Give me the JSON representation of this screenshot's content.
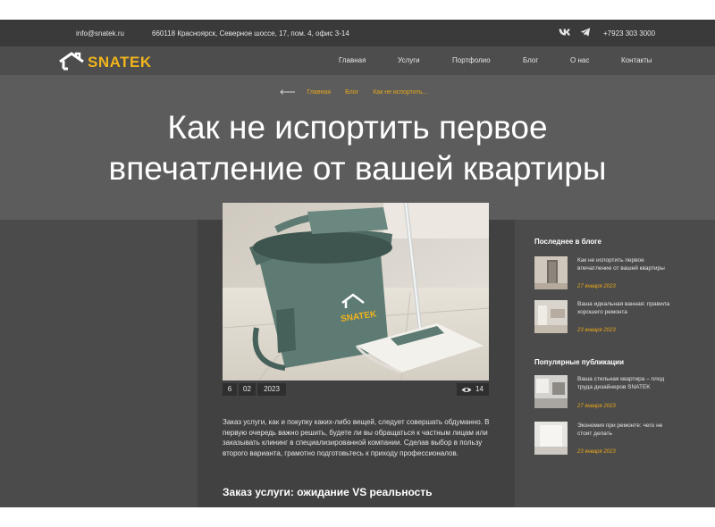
{
  "topbar": {
    "email": "info@snatek.ru",
    "address": "660118 Красноярск, Северное шоссе, 17, пом. 4, офис 3-14",
    "phone": "+7923 303 3000",
    "icons": [
      "vk-icon",
      "telegram-icon"
    ]
  },
  "logo": {
    "text": "SNATEK"
  },
  "nav": [
    "Главная",
    "Услуги",
    "Портфолио",
    "Блог",
    "О нас",
    "Контакты"
  ],
  "breadcrumb": [
    "Главная",
    "Блог",
    "Как не испортить..."
  ],
  "article": {
    "title_line1": "Как не испортить первое",
    "title_line2": "впечатление от вашей квартиры",
    "date": {
      "day": "6",
      "month": "02",
      "year": "2023"
    },
    "views": "14",
    "paragraph": "Заказ услуги, как и покупку каких-либо вещей, следует совершать обдуманно. В первую очередь важно решить, будете ли вы обращаться к частным лицам или заказывать клининг в специализированной компании. Сделав выбор в пользу второго варианта, грамотно подготовьтесь к приходу профессионалов.",
    "subheading": "Заказ услуги: ожидание VS реальность",
    "image_logo_text": "SNATEK"
  },
  "sidebar": {
    "latest_heading": "Последнее в блоге",
    "latest": [
      {
        "title": "Как не испортить первое впечатление от вашей квартиры",
        "date": "27 января 2023"
      },
      {
        "title": "Ваша идеальная ванная: правила хорошего ремонта",
        "date": "23 января 2023"
      }
    ],
    "popular_heading": "Популярные публикации",
    "popular": [
      {
        "title": "Ваша стильная квартира – плод труда дизайнеров SNATEK",
        "date": "27 января 2023"
      },
      {
        "title": "Экономия при ремонте: чего не стоит делать",
        "date": "23 января 2023"
      }
    ]
  },
  "colors": {
    "accent": "#f0b41c",
    "topbar": "#3a3a3a",
    "article_bg": "#414141"
  }
}
